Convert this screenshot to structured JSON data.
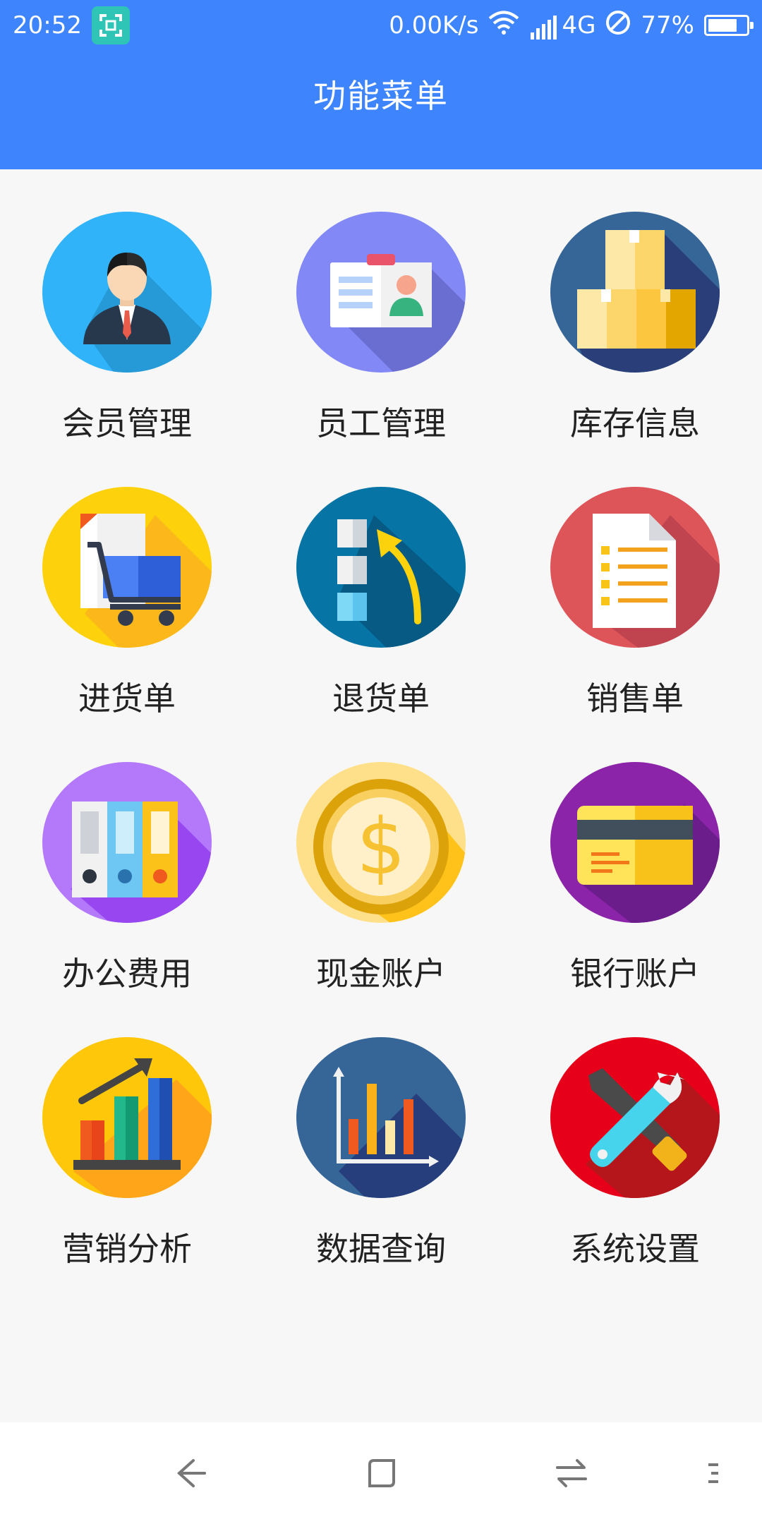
{
  "status": {
    "time": "20:52",
    "net_speed": "0.00K/s",
    "network": "4G",
    "battery": "77%",
    "battery_level": 0.77
  },
  "app": {
    "title": "功能菜单"
  },
  "menu": [
    {
      "label": "会员管理",
      "icon": "member-icon",
      "color": "#30b3f8"
    },
    {
      "label": "员工管理",
      "icon": "employee-card-icon",
      "color": "#8289f7"
    },
    {
      "label": "库存信息",
      "icon": "inventory-boxes-icon",
      "color": "#366597"
    },
    {
      "label": "进货单",
      "icon": "shopping-cart-icon",
      "color": "#fdd20c"
    },
    {
      "label": "退货单",
      "icon": "return-arrow-icon",
      "color": "#0675a6"
    },
    {
      "label": "销售单",
      "icon": "sales-document-icon",
      "color": "#dd5459"
    },
    {
      "label": "办公费用",
      "icon": "binders-icon",
      "color": "#b478fa"
    },
    {
      "label": "现金账户",
      "icon": "dollar-coin-icon",
      "color": "#ffe08a"
    },
    {
      "label": "银行账户",
      "icon": "bank-card-icon",
      "color": "#8b24a8"
    },
    {
      "label": "营销分析",
      "icon": "growth-chart-icon",
      "color": "#fec70a"
    },
    {
      "label": "数据查询",
      "icon": "bar-chart-icon",
      "color": "#366597"
    },
    {
      "label": "系统设置",
      "icon": "wrench-screwdriver-icon",
      "color": "#e6001a"
    }
  ],
  "nav": {
    "back": "back-icon",
    "home": "home-icon",
    "switch": "switch-icon",
    "menu": "menu-icon"
  }
}
